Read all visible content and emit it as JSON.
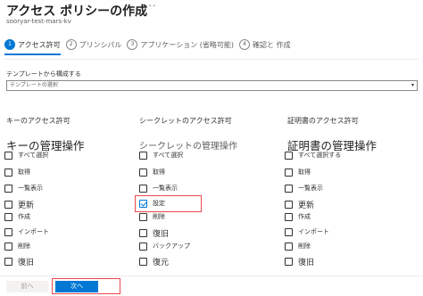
{
  "header": {
    "title": "アクセス ポリシーの作成",
    "more": "···",
    "subtitle": "sooryar-test-mars-kv"
  },
  "tabs": [
    {
      "step": "1",
      "label": "アクセス許可",
      "active": true
    },
    {
      "step": "2",
      "label": "プリンシパル"
    },
    {
      "step": "3",
      "label": "アプリケーション (省略可能)"
    },
    {
      "step": "4",
      "label": "確認と 作成"
    }
  ],
  "template": {
    "label": "テンプレートから構成する",
    "placeholder": "テンプレートの選択"
  },
  "columns": {
    "keys": {
      "heading": "キーのアクセス許可",
      "section": "キーの管理操作",
      "select_all": "すべて選択",
      "items": [
        {
          "label": "取得",
          "checked": false
        },
        {
          "label": "一覧表示",
          "checked": false
        },
        {
          "label": "更新",
          "checked": false
        },
        {
          "label": "作成",
          "checked": false
        },
        {
          "label": "インポート",
          "checked": false
        },
        {
          "label": "削除",
          "checked": false
        },
        {
          "label": "復旧",
          "checked": false
        }
      ]
    },
    "secrets": {
      "heading": "シークレットのアクセス許可",
      "section": "シークレットの管理操作",
      "select_all": "すべて選択",
      "items": [
        {
          "label": "取得",
          "checked": false
        },
        {
          "label": "一覧表示",
          "checked": false
        },
        {
          "label": "設定",
          "checked": true
        },
        {
          "label": "削除",
          "checked": false
        },
        {
          "label": "復旧",
          "checked": false
        },
        {
          "label": "バックアップ",
          "checked": false
        },
        {
          "label": "復元",
          "checked": false
        }
      ]
    },
    "certificates": {
      "heading": "証明書のアクセス許可",
      "section": "証明書の管理操作",
      "select_all": "すべて選択する",
      "items": [
        {
          "label": "取得",
          "checked": false
        },
        {
          "label": "一覧表示",
          "checked": false
        },
        {
          "label": "更新",
          "checked": false
        },
        {
          "label": "作成",
          "checked": false
        },
        {
          "label": "インポート",
          "checked": false
        },
        {
          "label": "削除",
          "checked": false
        },
        {
          "label": "復旧",
          "checked": false
        }
      ]
    }
  },
  "footer": {
    "prev_label": "前へ",
    "next_label": "次へ"
  },
  "colors": {
    "accent": "#0078d4",
    "highlight": "#e8474f"
  }
}
